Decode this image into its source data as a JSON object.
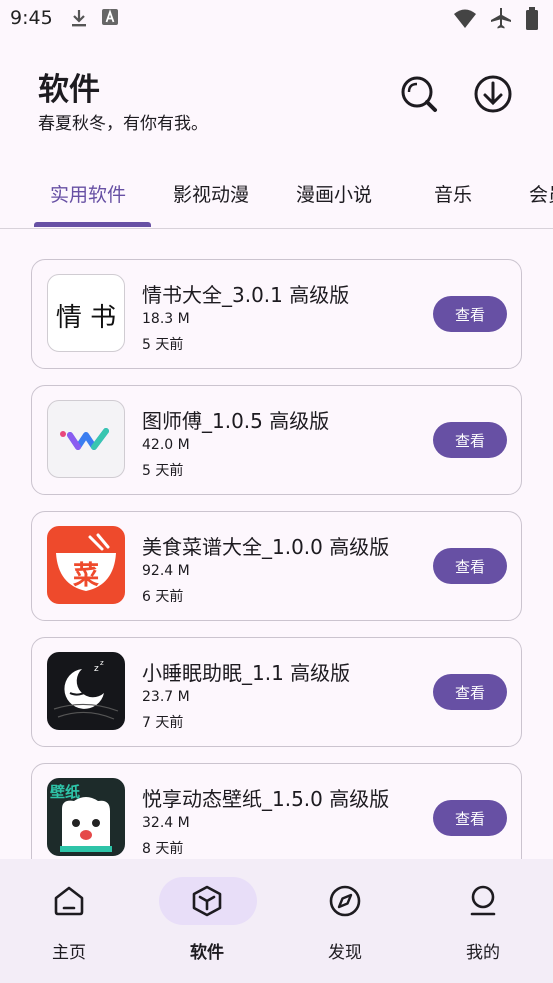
{
  "status_bar": {
    "time": "9:45",
    "left_icons": [
      "download-icon",
      "font-a-icon"
    ],
    "right_icons": [
      "wifi-icon",
      "airplane-icon",
      "battery-icon"
    ]
  },
  "header": {
    "title": "软件",
    "subtitle": "春夏秋冬，有你有我。",
    "actions": [
      "search-icon",
      "download-circle-icon"
    ]
  },
  "tabs": [
    {
      "label": "实用软件",
      "active": true
    },
    {
      "label": "影视动漫",
      "active": false
    },
    {
      "label": "漫画小说",
      "active": false
    },
    {
      "label": "音乐",
      "active": false
    },
    {
      "label": "会员",
      "active": false
    }
  ],
  "apps": [
    {
      "name": "情书大全_3.0.1 高级版",
      "size": "18.3 M",
      "time": "5 天前",
      "icon": "qingshu-app-icon",
      "icon_text": "情 书",
      "button": "查看"
    },
    {
      "name": "图师傅_1.0.5 高级版",
      "size": "42.0 M",
      "time": "5 天前",
      "icon": "tushifu-app-icon",
      "button": "查看"
    },
    {
      "name": "美食菜谱大全_1.0.0 高级版",
      "size": "92.4 M",
      "time": "6 天前",
      "icon": "recipe-app-icon",
      "icon_text": "菜",
      "button": "查看"
    },
    {
      "name": "小睡眠助眠_1.1 高级版",
      "size": "23.7 M",
      "time": "7 天前",
      "icon": "sleep-app-icon",
      "button": "查看"
    },
    {
      "name": "悦享动态壁纸_1.5.0 高级版",
      "size": "32.4 M",
      "time": "8 天前",
      "icon": "wallpaper-app-icon",
      "icon_text": "壁纸",
      "button": "查看"
    }
  ],
  "bottom_nav": [
    {
      "label": "主页",
      "icon": "home-icon",
      "active": false
    },
    {
      "label": "软件",
      "icon": "cube-icon",
      "active": true
    },
    {
      "label": "发现",
      "icon": "compass-icon",
      "active": false
    },
    {
      "label": "我的",
      "icon": "profile-icon",
      "active": false
    }
  ],
  "colors": {
    "accent": "#6750a4",
    "background": "#fdf7fd",
    "nav_background": "#f3edf7",
    "nav_active_pill": "#e8def8"
  }
}
